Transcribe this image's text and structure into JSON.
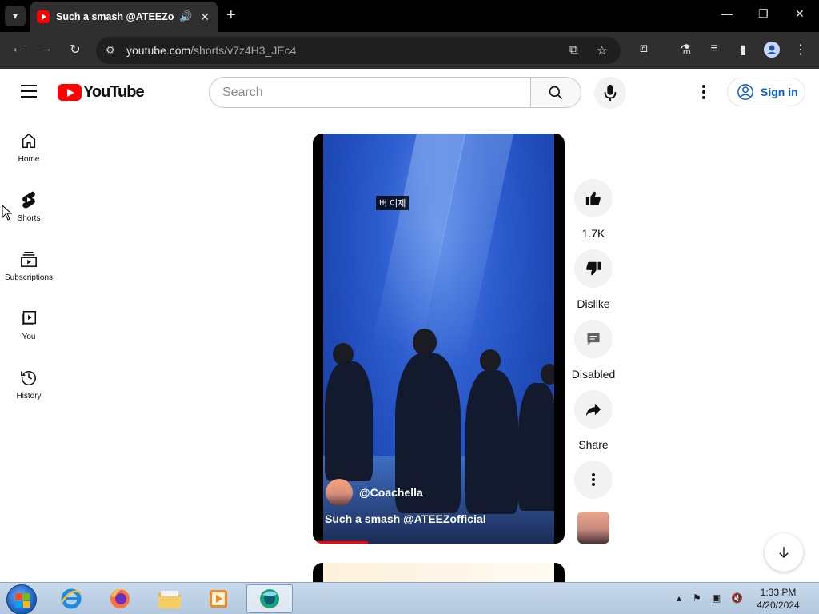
{
  "browser": {
    "tab_title": "Such a smash @ATEEZofficial",
    "url_host": "youtube.com",
    "url_path": "/shorts/v7z4H3_JEc4"
  },
  "header": {
    "logo_text": "YouTube",
    "search_placeholder": "Search",
    "signin_label": "Sign in"
  },
  "sidebar": {
    "items": [
      {
        "label": "Home",
        "icon": "home-icon"
      },
      {
        "label": "Shorts",
        "icon": "shorts-icon"
      },
      {
        "label": "Subscriptions",
        "icon": "subscriptions-icon"
      },
      {
        "label": "You",
        "icon": "you-icon"
      },
      {
        "label": "History",
        "icon": "history-icon"
      }
    ]
  },
  "short": {
    "caption_text": "버 이제",
    "channel": "@Coachella",
    "title": "Such a smash @ATEEZofficial",
    "progress_fraction": 0.22
  },
  "actions": {
    "like_count": "1.7K",
    "dislike_label": "Dislike",
    "comments_label": "Disabled",
    "share_label": "Share"
  },
  "taskbar": {
    "time": "1:33 PM",
    "date": "4/20/2024"
  },
  "colors": {
    "brand_red": "#ff0000",
    "link_blue": "#065fd4"
  }
}
